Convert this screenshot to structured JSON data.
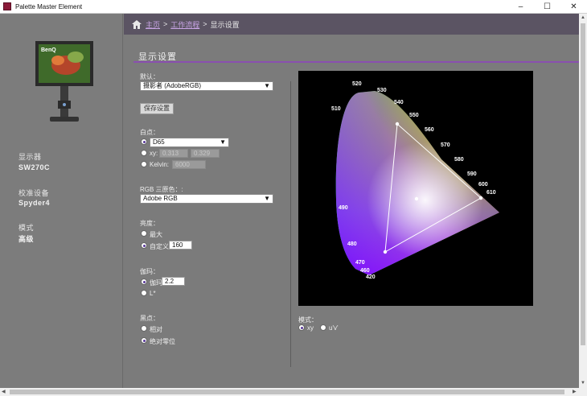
{
  "window": {
    "title": "Palette Master Element"
  },
  "breadcrumb": {
    "home": "主页",
    "workflow": "工作流程",
    "current": "显示设置",
    "sep": ">"
  },
  "sidebar": {
    "brand": "BenQ",
    "display_label": "显示器",
    "display_value": "SW270C",
    "device_label": "校准设备",
    "device_value": "Spyder4",
    "mode_label": "模式",
    "mode_value": "高级"
  },
  "main": {
    "title": "显示设置",
    "default_label": "默认：",
    "default_value": "摄影者 (AdobeRGB)",
    "save_button": "保存设置",
    "whitepoint_label": "白点：",
    "wp_d65": "D65",
    "wp_xy_label": "xy:",
    "wp_x": "0.313",
    "wp_y": "0.329",
    "wp_kelvin_label": "Kelvin:",
    "wp_kelvin": "6000",
    "rgb_label": "RGB 三原色：:",
    "rgb_value": "Adobe RGB",
    "brightness_label": "亮度：",
    "br_max": "最大",
    "br_custom": "自定义",
    "br_value": "160",
    "gamma_label": "伽玛：",
    "gm_gamma": "伽玛",
    "gm_value": "2.2",
    "gm_lstar": "L*",
    "black_label": "黑点：",
    "bk_relative": "相对",
    "bk_absolute": "绝对零位",
    "chart_mode_label": "模式：",
    "chart_mode_xy": "xy",
    "chart_mode_uv": "u'v'"
  },
  "chart_data": {
    "type": "scatter",
    "title": "",
    "wavelength_labels": [
      "420",
      "460",
      "470",
      "480",
      "490",
      "510",
      "520",
      "530",
      "540",
      "550",
      "560",
      "570",
      "580",
      "590",
      "600",
      "610"
    ],
    "gamut_triangle": [
      {
        "x": 0.64,
        "y": 0.33
      },
      {
        "x": 0.21,
        "y": 0.71
      },
      {
        "x": 0.15,
        "y": 0.06
      }
    ],
    "white_point": {
      "x": 0.313,
      "y": 0.329
    }
  }
}
